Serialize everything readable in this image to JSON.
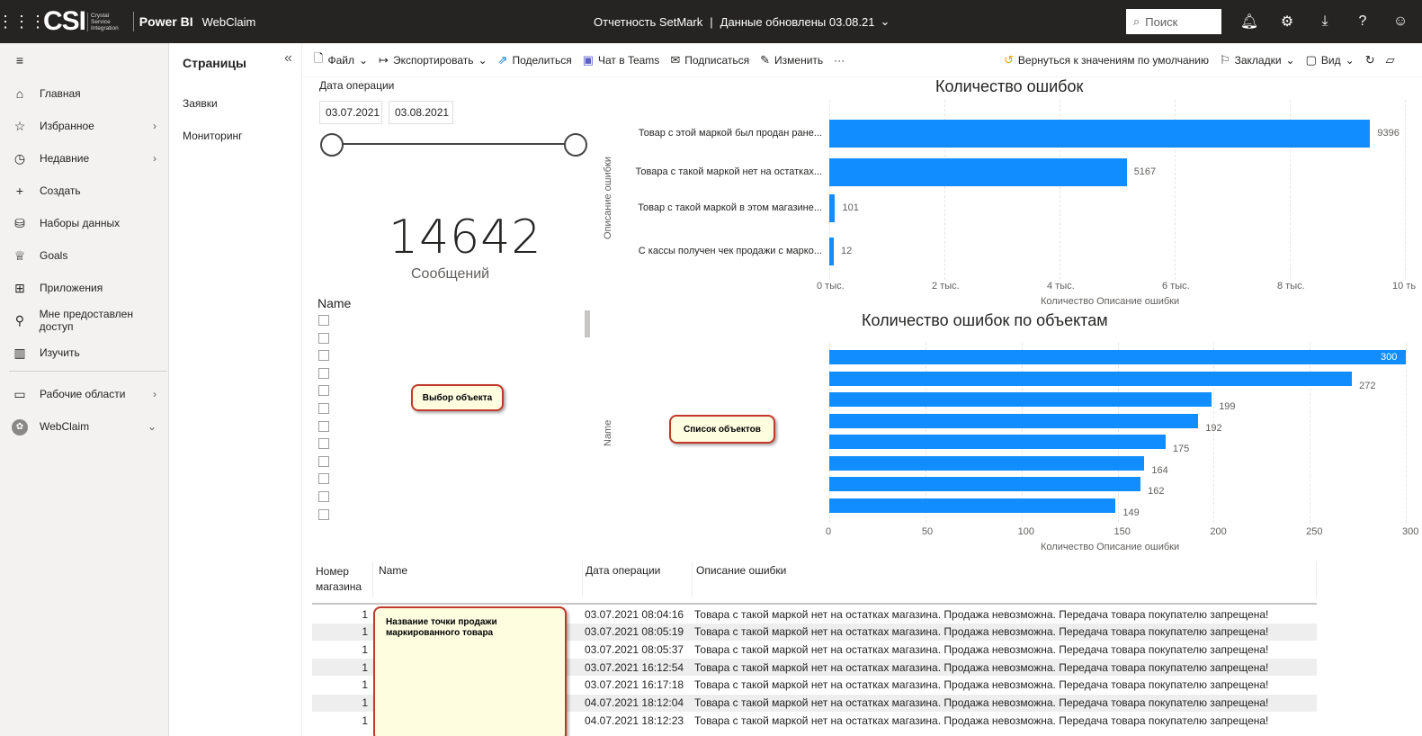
{
  "topbar": {
    "logo": "CSI",
    "logo_sub": [
      "Crystal",
      "Service",
      "Integration"
    ],
    "product": "Power BI",
    "workspace": "WebClaim",
    "report_name": "Отчетность SetMark",
    "updated": "Данные обновлены 03.08.21",
    "search_placeholder": "Поиск"
  },
  "nav": {
    "items": [
      {
        "label": "Главная",
        "icon": "home-icon"
      },
      {
        "label": "Избранное",
        "icon": "star-icon"
      },
      {
        "label": "Недавние",
        "icon": "clock-icon"
      },
      {
        "label": "Создать",
        "icon": "plus-icon"
      },
      {
        "label": "Наборы данных",
        "icon": "database-icon"
      },
      {
        "label": "Goals",
        "icon": "trophy-icon"
      },
      {
        "label": "Приложения",
        "icon": "apps-icon"
      },
      {
        "label": "Мне предоставлен доступ",
        "icon": "shared-icon"
      },
      {
        "label": "Изучить",
        "icon": "book-icon"
      },
      {
        "label": "Рабочие области",
        "icon": "workspaces-icon"
      },
      {
        "label": "WebClaim",
        "icon": "workspace-avatar-icon"
      }
    ]
  },
  "pages": {
    "title": "Страницы",
    "items": [
      "Заявки",
      "Мониторинг"
    ]
  },
  "actions": {
    "file": "Файл",
    "export": "Экспортировать",
    "share": "Поделиться",
    "teams": "Чат в Teams",
    "subscribe": "Подписаться",
    "edit": "Изменить",
    "more": "···",
    "reset": "Вернуться к значениям по умолчанию",
    "bookmarks": "Закладки",
    "view": "Вид"
  },
  "slicer": {
    "title": "Дата операции",
    "start": "03.07.2021",
    "end": "03.08.2021"
  },
  "kpi": {
    "value": "14642",
    "label": "Сообщений"
  },
  "name_slicer": {
    "title": "Name"
  },
  "callouts": {
    "object_select": "Выбор объекта",
    "object_list": "Список объектов",
    "point_name": "Название точки продажи маркированного товара"
  },
  "chart_data": [
    {
      "type": "bar",
      "title": "Количество ошибок",
      "ylabel": "Описание ошибки",
      "xlabel": "Количество Описание ошибки",
      "categories": [
        "Товар с этой маркой был продан ране...",
        "Товара с такой маркой нет на остатках...",
        "Товар с такой маркой в этом магазине...",
        "С кассы получен чек продажи с марко..."
      ],
      "values": [
        9396,
        5167,
        101,
        12
      ],
      "xlim": [
        0,
        10000
      ],
      "ticks": [
        "0 тыс.",
        "2 тыс.",
        "4 тыс.",
        "6 тыс.",
        "8 тыс.",
        "10 ть"
      ]
    },
    {
      "type": "bar",
      "title": "Количество ошибок по объектам",
      "ylabel": "Name",
      "xlabel": "Количество Описание ошибки",
      "values": [
        300,
        272,
        199,
        192,
        175,
        164,
        162,
        149
      ],
      "xlim": [
        0,
        300
      ],
      "ticks": [
        "0",
        "50",
        "100",
        "150",
        "200",
        "250",
        "300"
      ]
    }
  ],
  "table": {
    "headers": [
      "Номер магазина",
      "Name",
      "Дата операции",
      "Описание ошибки"
    ],
    "rows": [
      {
        "num": "1",
        "date": "03.07.2021 08:04:16",
        "desc": "Товара с такой маркой нет на остатках магазина. Продажа невозможна. Передача товара покупателю запрещена!"
      },
      {
        "num": "1",
        "date": "03.07.2021 08:05:19",
        "desc": "Товара с такой маркой нет на остатках магазина. Продажа невозможна. Передача товара покупателю запрещена!"
      },
      {
        "num": "1",
        "date": "03.07.2021 08:05:37",
        "desc": "Товара с такой маркой нет на остатках магазина. Продажа невозможна. Передача товара покупателю запрещена!"
      },
      {
        "num": "1",
        "date": "03.07.2021 16:12:54",
        "desc": "Товара с такой маркой нет на остатках магазина. Продажа невозможна. Передача товара покупателю запрещена!"
      },
      {
        "num": "1",
        "date": "03.07.2021 16:17:18",
        "desc": "Товара с такой маркой нет на остатках магазина. Продажа невозможна. Передача товара покупателю запрещена!"
      },
      {
        "num": "1",
        "date": "04.07.2021 18:12:04",
        "desc": "Товара с такой маркой нет на остатках магазина. Продажа невозможна. Передача товара покупателю запрещена!"
      },
      {
        "num": "1",
        "date": "04.07.2021 18:12:23",
        "desc": "Товара с такой маркой нет на остатках магазина. Продажа невозможна. Передача товара покупателю запрещена!"
      }
    ]
  },
  "colors": {
    "bar": "#118dff",
    "topbar": "#252423",
    "callout_border": "#c0392b",
    "callout_fill": "#fffde0"
  }
}
